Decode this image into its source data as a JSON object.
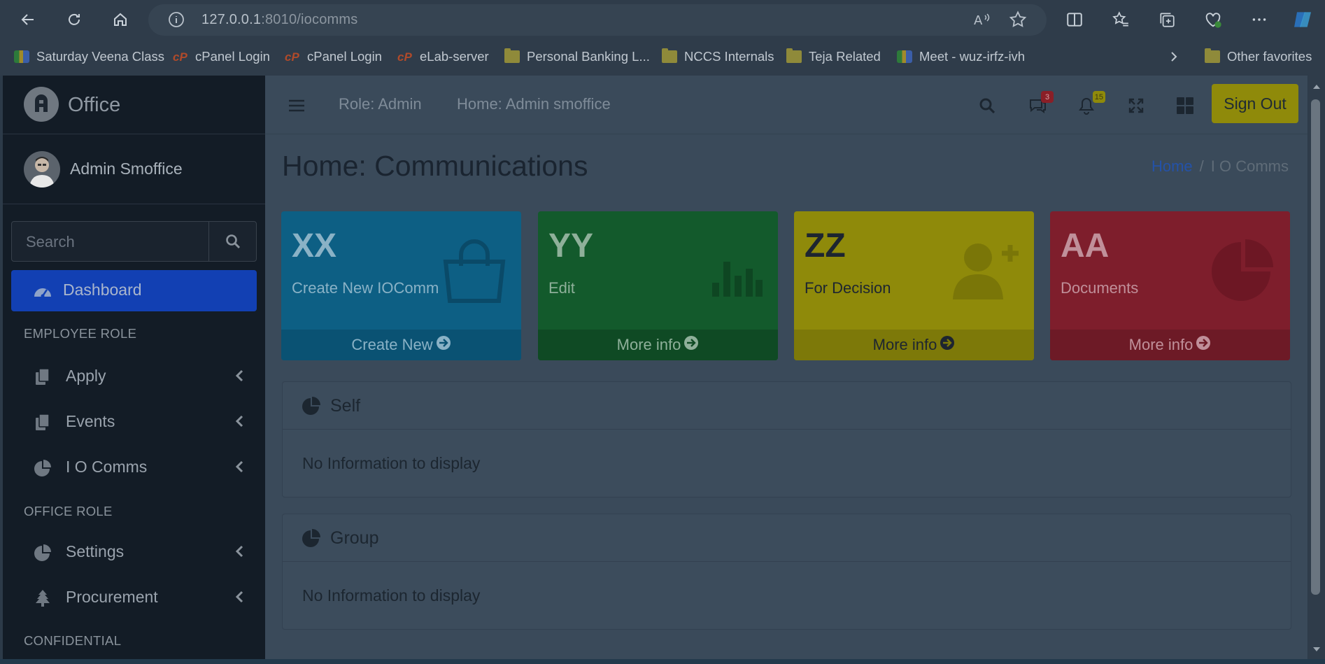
{
  "browser": {
    "url_host": "127.0.0.1",
    "url_path": ":8010/iocomms",
    "bookmarks": [
      {
        "label": "Saturday Veena Class",
        "icon": "meet-icon"
      },
      {
        "label": "cPanel Login",
        "icon": "cpanel-icon"
      },
      {
        "label": "cPanel Login",
        "icon": "cpanel-icon"
      },
      {
        "label": "eLab-server",
        "icon": "cpanel-icon"
      },
      {
        "label": "Personal Banking L...",
        "icon": "folder-icon"
      },
      {
        "label": "NCCS Internals",
        "icon": "folder-icon"
      },
      {
        "label": "Teja Related",
        "icon": "folder-icon"
      },
      {
        "label": "Meet - wuz-irfz-ivh",
        "icon": "meet-icon"
      }
    ],
    "other_favorites": "Other favorites"
  },
  "sidebar": {
    "brand": "Office",
    "user": "Admin Smoffice",
    "search_placeholder": "Search",
    "active_item": "Dashboard",
    "employee_header": "EMPLOYEE ROLE",
    "employee_items": [
      {
        "label": "Apply",
        "icon": "copy-icon"
      },
      {
        "label": "Events",
        "icon": "copy-icon"
      },
      {
        "label": "I O Comms",
        "icon": "pie-chart-icon"
      }
    ],
    "office_header": "OFFICE ROLE",
    "office_items": [
      {
        "label": "Settings",
        "icon": "pie-chart-icon"
      },
      {
        "label": "Procurement",
        "icon": "tree-icon"
      }
    ],
    "confidential_header": "CONFIDENTIAL"
  },
  "navbar": {
    "role": "Role: Admin",
    "home": "Home: Admin smoffice",
    "messages_count": "3",
    "notifications_count": "15",
    "sign_out": "Sign Out"
  },
  "page": {
    "title": "Home: Communications",
    "breadcrumb_home": "Home",
    "breadcrumb_sep": "/",
    "breadcrumb_current": "I O Comms"
  },
  "boxes": [
    {
      "big": "XX",
      "sub": "Create New IOComm",
      "footer": "Create New",
      "color": "#0d5f84",
      "icon": "shopping-bag-icon"
    },
    {
      "big": "YY",
      "sub": "Edit",
      "footer": "More info",
      "color": "#135a2c",
      "icon": "bar-chart-icon"
    },
    {
      "big": "ZZ",
      "sub": "For Decision",
      "footer": "More info",
      "color": "#8f8a0a",
      "icon": "user-plus-icon"
    },
    {
      "big": "AA",
      "sub": "Documents",
      "footer": "More info",
      "color": "#7e1e2c",
      "icon": "pie-chart-icon"
    }
  ],
  "cards": [
    {
      "title": "Self",
      "body": "No Information to display"
    },
    {
      "title": "Group",
      "body": "No Information to display"
    }
  ]
}
